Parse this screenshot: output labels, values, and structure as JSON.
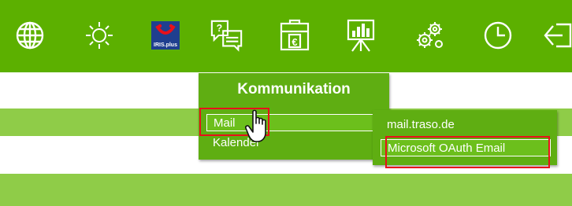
{
  "toolbar": {
    "icons": [
      "globe-icon",
      "sun-icon",
      "iris-plus-logo",
      "chat-question-icon",
      "euro-briefcase-icon",
      "presentation-chart-icon",
      "gears-icon",
      "clock-icon",
      "exit-arrow-icon"
    ],
    "logo_text": "IRIS.plus",
    "bar_color": "#5cb000"
  },
  "menu": {
    "title": "Kommunikation",
    "items": [
      {
        "label": "Mail"
      },
      {
        "label": "Kalender"
      }
    ],
    "submenu": [
      {
        "label": "mail.traso.de"
      },
      {
        "label": "Microsoft OAuth Email"
      }
    ]
  },
  "colors": {
    "menu_bg": "#5fae12",
    "band": "#8fcc48",
    "highlight": "#e8101a"
  }
}
